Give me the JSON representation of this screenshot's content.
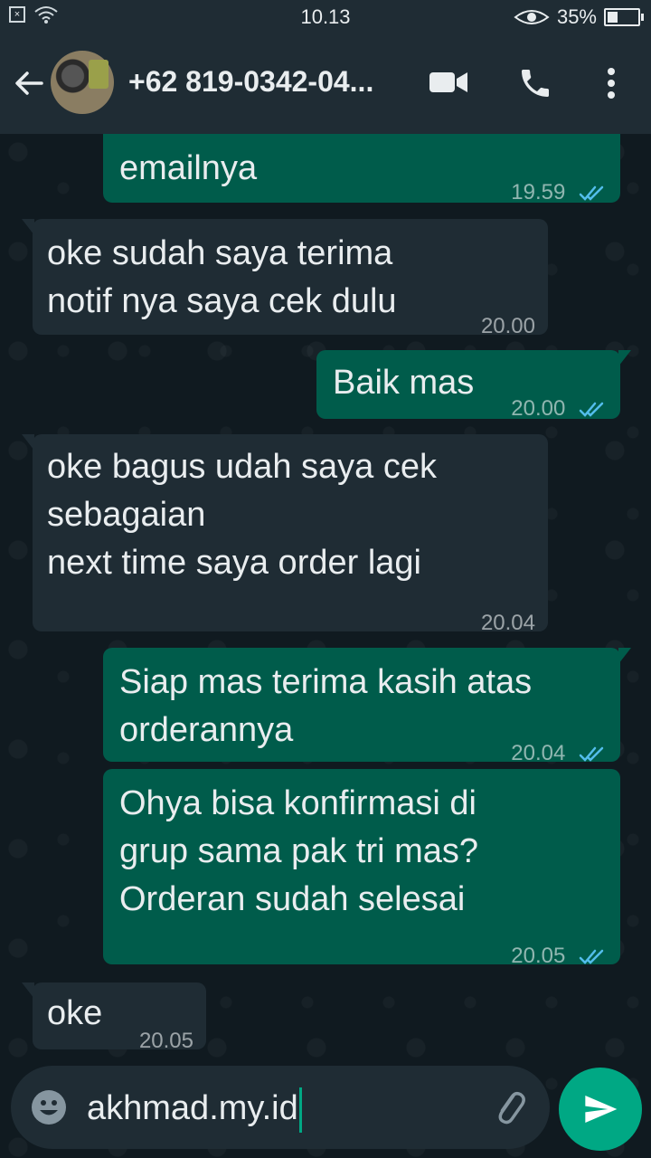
{
  "status_bar": {
    "time": "10.13",
    "battery": "35%",
    "battery_level": 0.35
  },
  "header": {
    "contact_name": "+62 819-0342-04..."
  },
  "messages": [
    {
      "dir": "out",
      "text": "emailnya",
      "time": "19.59",
      "read": true
    },
    {
      "dir": "in",
      "text": "oke sudah saya terima\nnotif nya saya cek dulu",
      "time": "20.00"
    },
    {
      "dir": "out",
      "text": "Baik mas",
      "time": "20.00",
      "read": true
    },
    {
      "dir": "in",
      "text": "oke bagus udah saya cek\nsebagaian\nnext time saya order lagi",
      "time": "20.04"
    },
    {
      "dir": "out",
      "text": "Siap mas terima kasih atas\norderannya",
      "time": "20.04",
      "read": true
    },
    {
      "dir": "out",
      "text": "Ohya bisa konfirmasi di\ngrup sama pak tri mas?\nOrderan sudah selesai",
      "time": "20.05",
      "read": true
    },
    {
      "dir": "in",
      "text": "oke",
      "time": "20.05"
    }
  ],
  "composer": {
    "text": "akhmad.my.id"
  },
  "colors": {
    "bubble_out": "#005c4b",
    "bubble_in": "#1f2c34",
    "read_tick": "#53bdeb",
    "accent": "#00a884"
  },
  "icons": [
    "back-arrow-icon",
    "video-call-icon",
    "phone-icon",
    "more-vert-icon",
    "emoji-icon",
    "attach-icon",
    "send-icon",
    "wifi-icon",
    "eye-icon",
    "battery-icon"
  ]
}
